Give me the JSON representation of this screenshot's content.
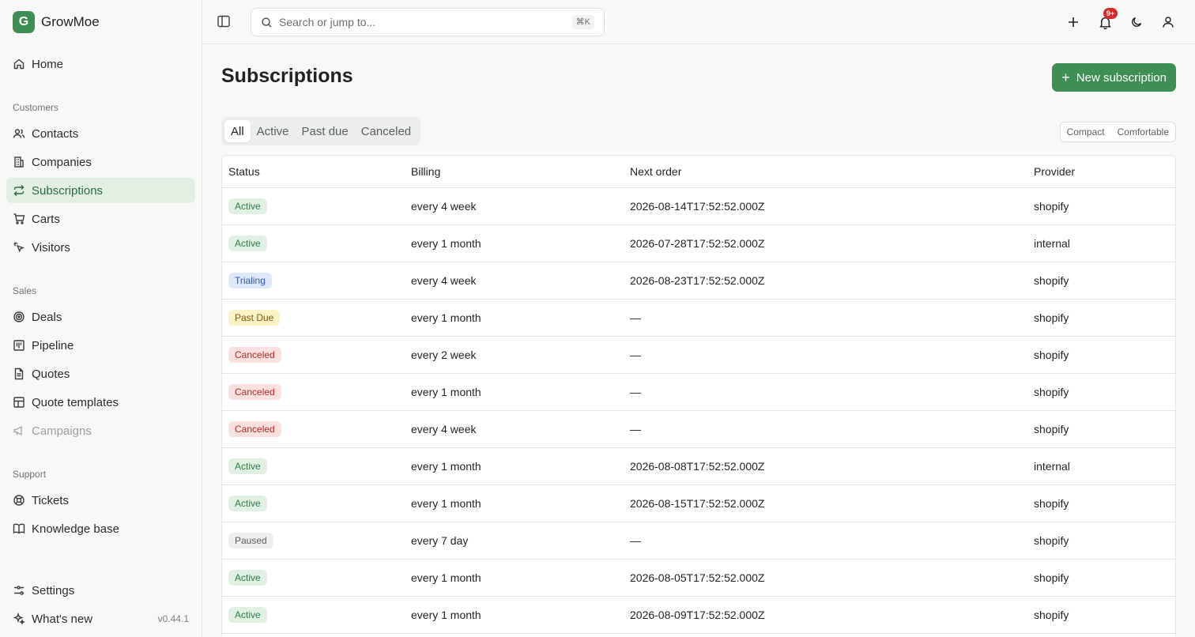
{
  "brand": {
    "letter": "G",
    "name": "GrowMoe"
  },
  "sidebar": {
    "home": "Home",
    "sections": {
      "customers": "Customers",
      "sales": "Sales",
      "support": "Support"
    },
    "customers": [
      "Contacts",
      "Companies",
      "Subscriptions",
      "Carts",
      "Visitors"
    ],
    "sales": [
      "Deals",
      "Pipeline",
      "Quotes",
      "Quote templates",
      "Campaigns"
    ],
    "support": [
      "Tickets",
      "Knowledge base"
    ],
    "settings": "Settings",
    "whats_new": "What's new",
    "version": "v0.44.1"
  },
  "topbar": {
    "search_placeholder": "Search or jump to...",
    "search_shortcut": "⌘K",
    "notification_count": "9+"
  },
  "page": {
    "title": "Subscriptions",
    "new_button": "New subscription",
    "tabs": [
      "All",
      "Active",
      "Past due",
      "Canceled"
    ],
    "selected_tab": "All",
    "density": [
      "Compact",
      "Comfortable"
    ]
  },
  "table": {
    "headers": [
      "Status",
      "Billing",
      "Next order",
      "Provider"
    ],
    "rows": [
      {
        "status": "Active",
        "kind": "active",
        "billing": "every 4 week",
        "next": "2026-08-14T17:52:52.000Z",
        "provider": "shopify"
      },
      {
        "status": "Active",
        "kind": "active",
        "billing": "every 1 month",
        "next": "2026-07-28T17:52:52.000Z",
        "provider": "internal"
      },
      {
        "status": "Trialing",
        "kind": "trialing",
        "billing": "every 4 week",
        "next": "2026-08-23T17:52:52.000Z",
        "provider": "shopify"
      },
      {
        "status": "Past Due",
        "kind": "pastdue",
        "billing": "every 1 month",
        "next": "—",
        "provider": "shopify"
      },
      {
        "status": "Canceled",
        "kind": "canceled",
        "billing": "every 2 week",
        "next": "—",
        "provider": "shopify"
      },
      {
        "status": "Canceled",
        "kind": "canceled",
        "billing": "every 1 month",
        "next": "—",
        "provider": "shopify"
      },
      {
        "status": "Canceled",
        "kind": "canceled",
        "billing": "every 4 week",
        "next": "—",
        "provider": "shopify"
      },
      {
        "status": "Active",
        "kind": "active",
        "billing": "every 1 month",
        "next": "2026-08-08T17:52:52.000Z",
        "provider": "internal"
      },
      {
        "status": "Active",
        "kind": "active",
        "billing": "every 1 month",
        "next": "2026-08-15T17:52:52.000Z",
        "provider": "shopify"
      },
      {
        "status": "Paused",
        "kind": "paused",
        "billing": "every 7 day",
        "next": "—",
        "provider": "shopify"
      },
      {
        "status": "Active",
        "kind": "active",
        "billing": "every 1 month",
        "next": "2026-08-05T17:52:52.000Z",
        "provider": "shopify"
      },
      {
        "status": "Active",
        "kind": "active",
        "billing": "every 1 month",
        "next": "2026-08-09T17:52:52.000Z",
        "provider": "shopify"
      }
    ]
  },
  "colors": {
    "accent": "#3f8f55",
    "active_nav_bg": "#e2efe3"
  }
}
